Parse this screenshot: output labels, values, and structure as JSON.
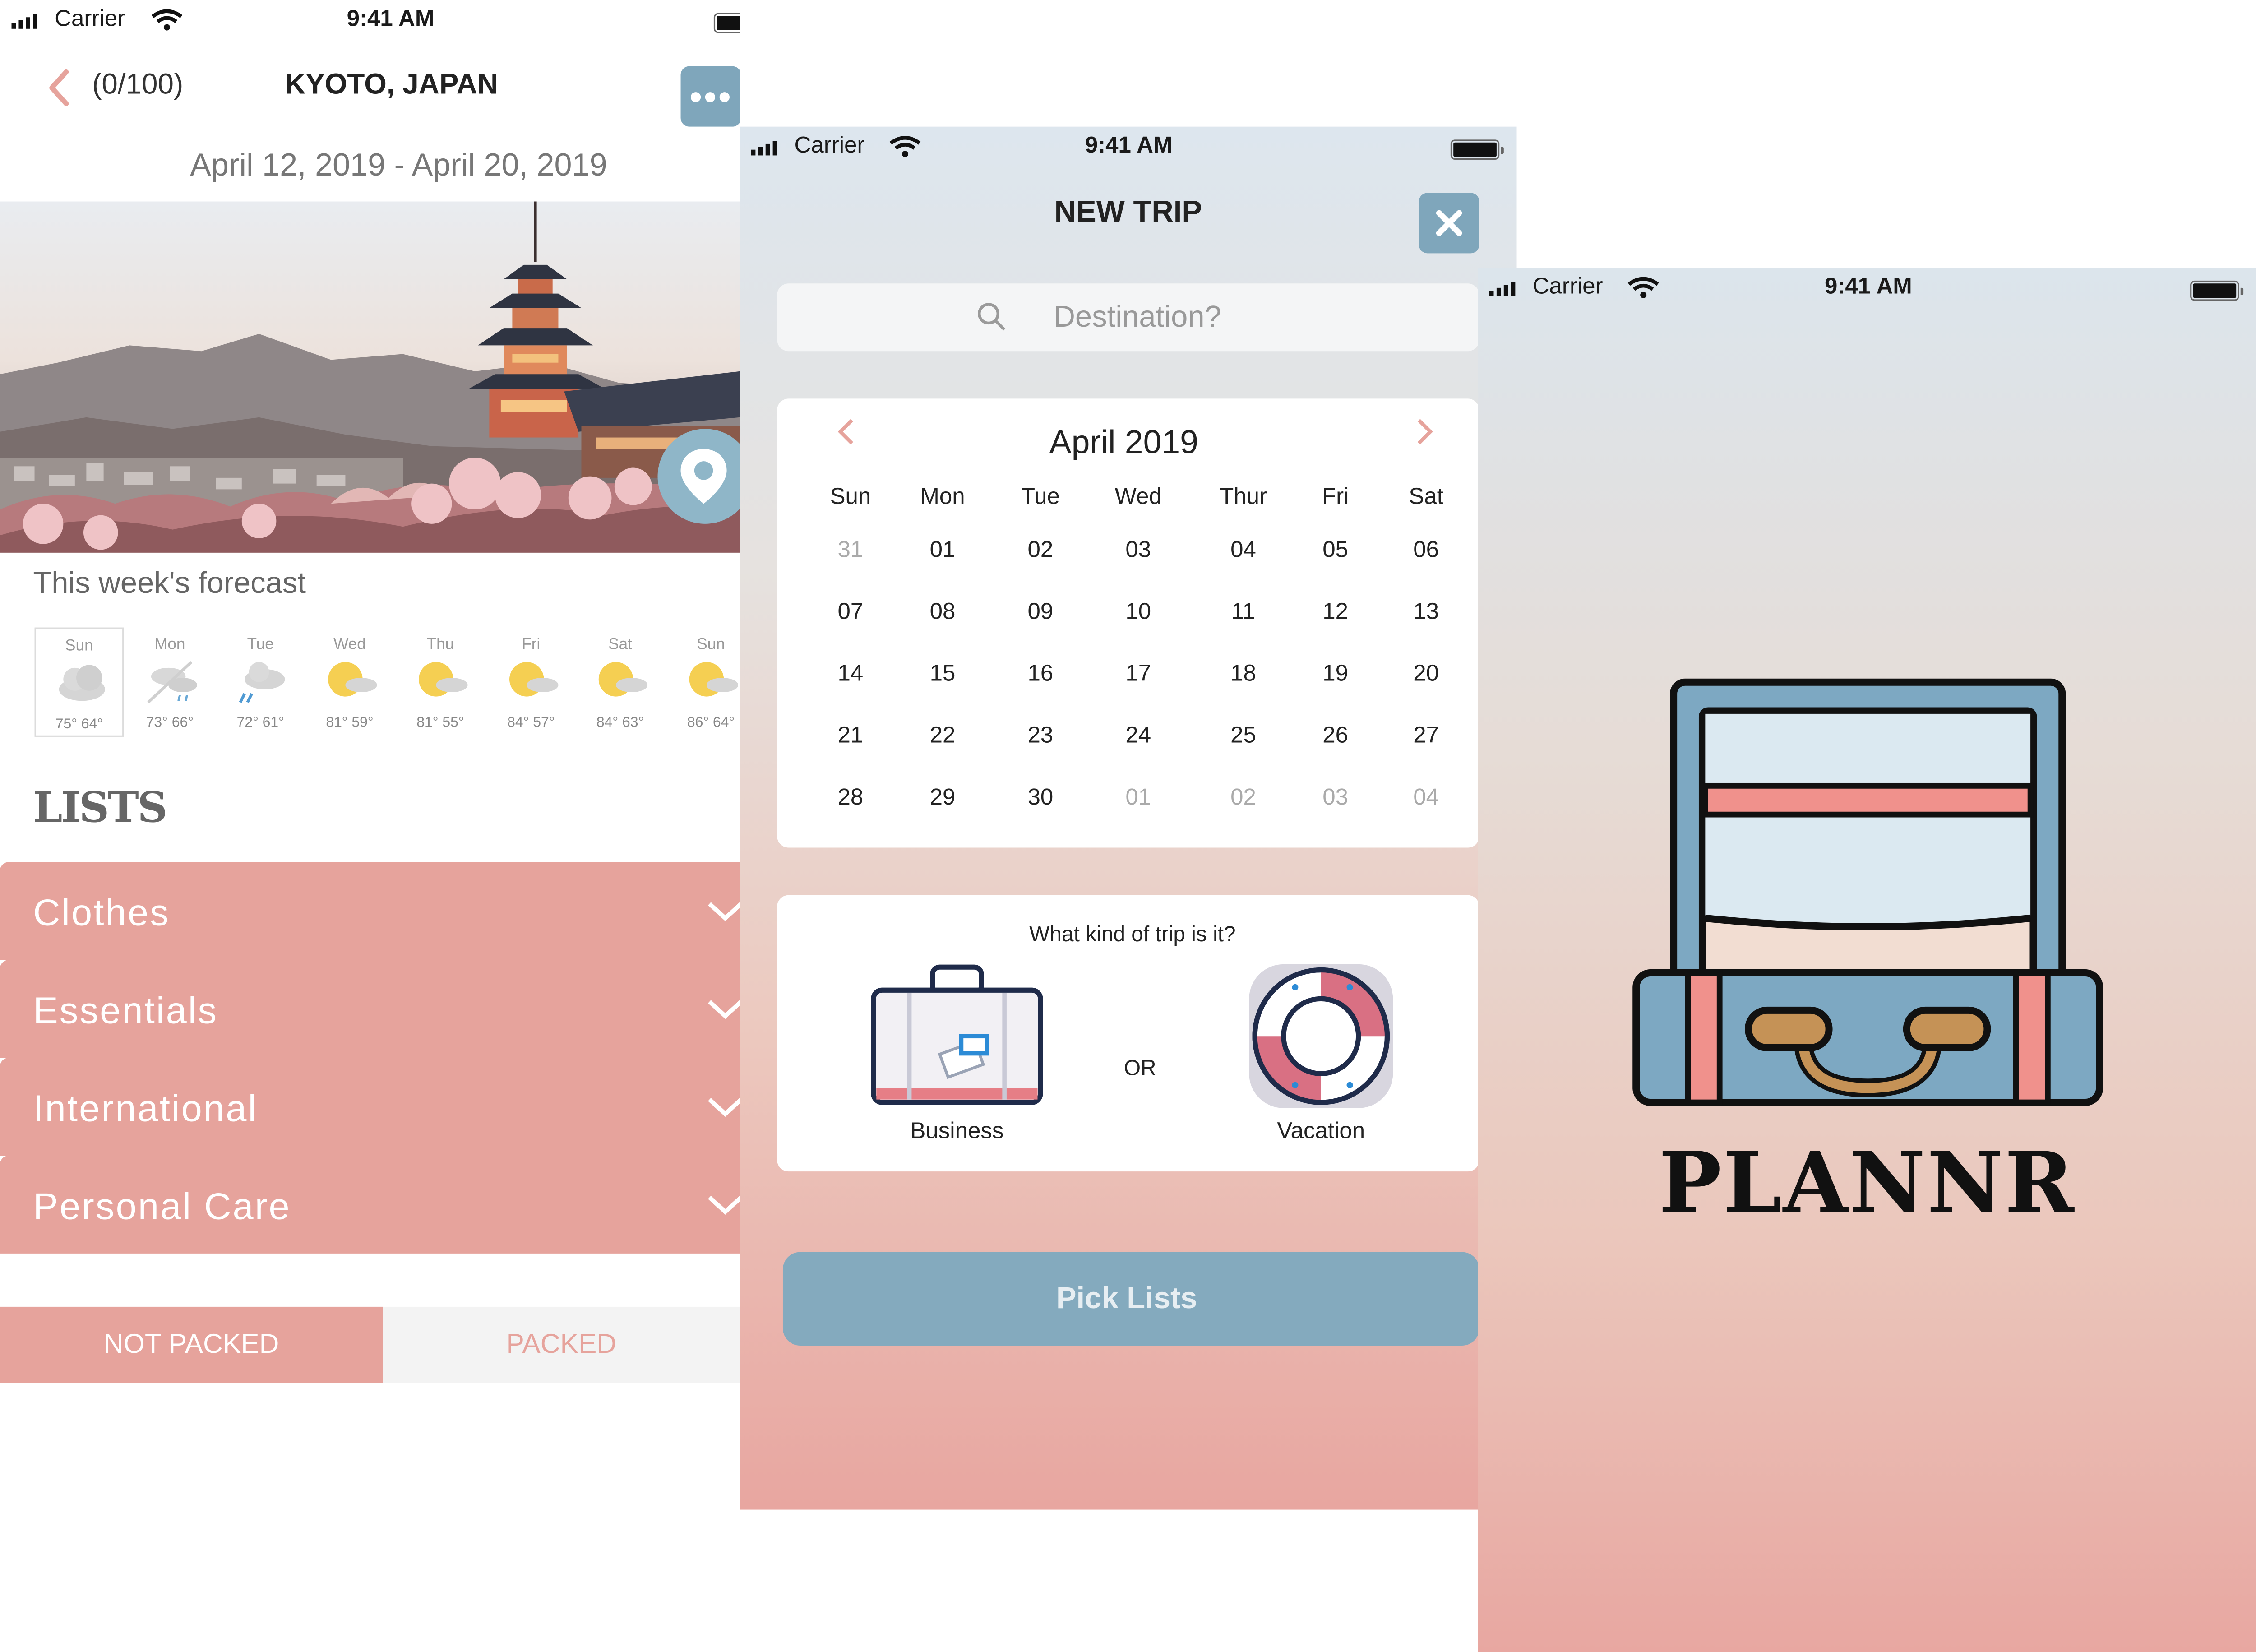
{
  "status_bar": {
    "carrier": "Carrier",
    "time": "9:41 AM"
  },
  "trip": {
    "count": "(0/100)",
    "title": "KYOTO, JAPAN",
    "dates": "April 12, 2019 - April 20, 2019",
    "forecast_title": "This week's forecast",
    "forecast": [
      {
        "day": "Sun",
        "temps": "75° 64°",
        "icon": "cloudy-icon"
      },
      {
        "day": "Mon",
        "temps": "73° 66°",
        "icon": "rain-icon"
      },
      {
        "day": "Tue",
        "temps": "72° 61°",
        "icon": "rain-icon"
      },
      {
        "day": "Wed",
        "temps": "81° 59°",
        "icon": "partly-sunny-icon"
      },
      {
        "day": "Thu",
        "temps": "81° 55°",
        "icon": "partly-sunny-icon"
      },
      {
        "day": "Fri",
        "temps": "84° 57°",
        "icon": "partly-sunny-icon"
      },
      {
        "day": "Sat",
        "temps": "84° 63°",
        "icon": "partly-sunny-icon"
      },
      {
        "day": "Sun",
        "temps": "86° 64°",
        "icon": "partly-sunny-icon"
      }
    ],
    "lists_title": "LISTS",
    "lists": [
      "Clothes",
      "Essentials",
      "International",
      "Personal Care"
    ],
    "tabs": {
      "not_packed": "NOT PACKED",
      "packed": "PACKED"
    }
  },
  "new_trip": {
    "title": "NEW TRIP",
    "search_placeholder": "Destination?",
    "calendar": {
      "month": "April 2019",
      "weekdays": [
        "Sun",
        "Mon",
        "Tue",
        "Wed",
        "Thur",
        "Fri",
        "Sat"
      ],
      "weeks": [
        [
          "31",
          "01",
          "02",
          "03",
          "04",
          "05",
          "06"
        ],
        [
          "07",
          "08",
          "09",
          "10",
          "11",
          "12",
          "13"
        ],
        [
          "14",
          "15",
          "16",
          "17",
          "18",
          "19",
          "20"
        ],
        [
          "21",
          "22",
          "23",
          "24",
          "25",
          "26",
          "27"
        ],
        [
          "28",
          "29",
          "30",
          "01",
          "02",
          "03",
          "04"
        ]
      ]
    },
    "trip_kind_question": "What kind of trip is it?",
    "or": "OR",
    "business": "Business",
    "vacation": "Vacation",
    "pick_lists": "Pick Lists"
  },
  "splash": {
    "brand": "PLANNR"
  },
  "colors": {
    "accent_pink": "#e6a39c",
    "accent_blue": "#7fa6bb"
  }
}
